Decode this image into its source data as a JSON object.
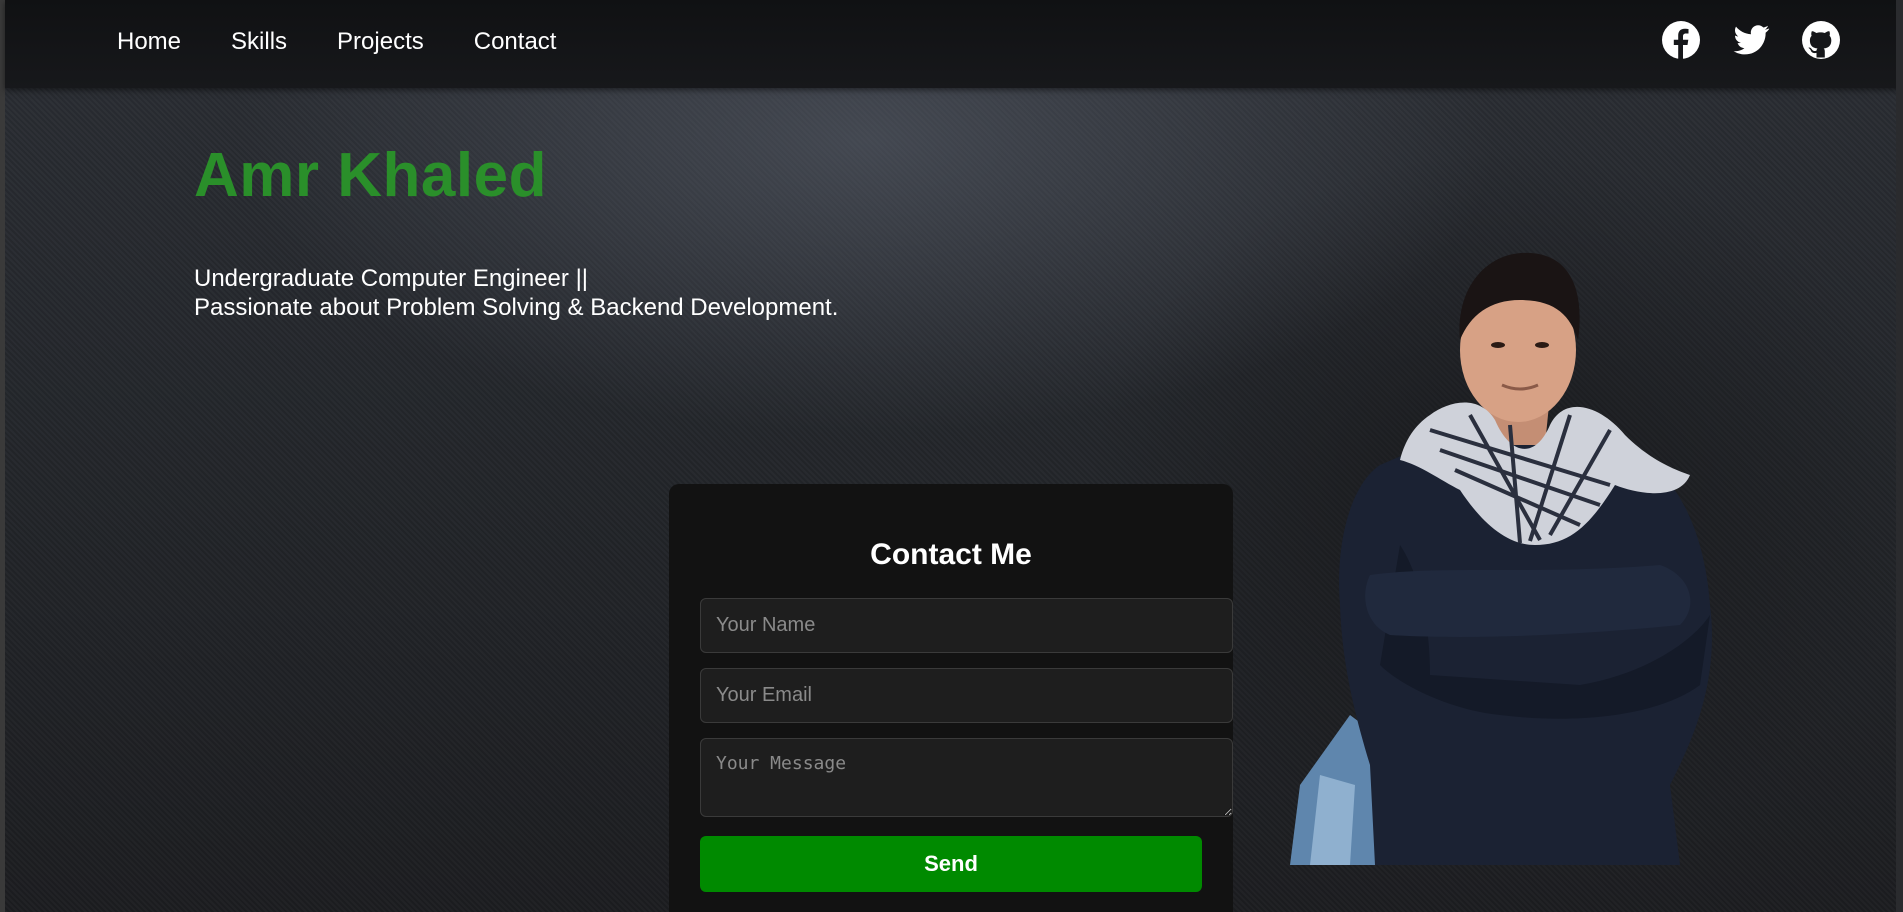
{
  "nav": {
    "links": [
      "Home",
      "Skills",
      "Projects",
      "Contact"
    ],
    "social": [
      "facebook-icon",
      "twitter-icon",
      "github-icon"
    ]
  },
  "hero": {
    "name": "Amr Khaled",
    "line1": "Undergraduate Computer Engineer ||",
    "line2": "Passionate about Problem Solving & Backend Development."
  },
  "contact": {
    "title": "Contact Me",
    "name_placeholder": "Your Name",
    "email_placeholder": "Your Email",
    "message_placeholder": "Your Message",
    "send_label": "Send"
  },
  "colors": {
    "accent_green": "#2a8f2a",
    "button_green": "#008a00",
    "card_bg": "#121212",
    "nav_bg": "#101113"
  }
}
